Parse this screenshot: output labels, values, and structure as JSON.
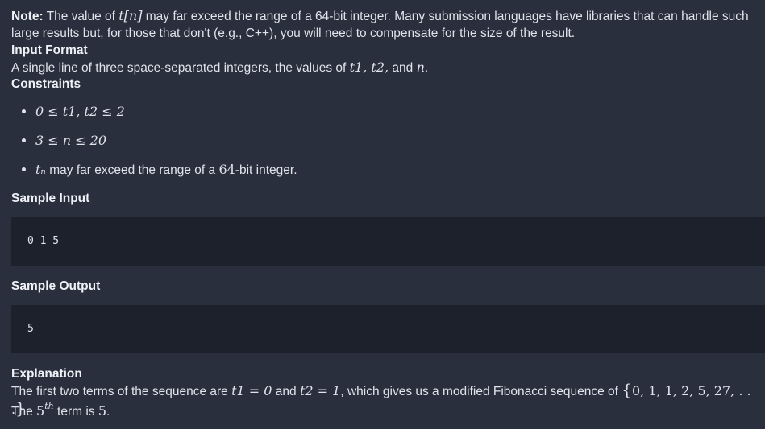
{
  "note": {
    "label": "Note:",
    "text_before": " The value of ",
    "math_t_n": "t[n]",
    "text_after": " may far exceed the range of a 64-bit integer. Many submission languages have libraries that can handle such large results but, for those that don't (e.g., C++), you will need to compensate for the size of the result."
  },
  "input_format": {
    "heading": "Input Format",
    "text_before": "A single line of three space-separated integers, the values of ",
    "math_vars": "t1, t2,",
    "text_and": " and ",
    "math_n": "n",
    "text_end": "."
  },
  "constraints": {
    "heading": "Constraints",
    "items": [
      {
        "math": "0 ≤ t1, t2 ≤ 2"
      },
      {
        "math": "3 ≤ n ≤ 20"
      },
      {
        "math": "tₙ",
        "text": " may far exceed the range of a ",
        "math2": "64",
        "text2": "-bit integer."
      }
    ]
  },
  "sample_input": {
    "heading": "Sample Input",
    "code": "0 1 5"
  },
  "sample_output": {
    "heading": "Sample Output",
    "code": "5"
  },
  "explanation": {
    "heading": "Explanation",
    "line1_before": "The first two terms of the sequence are ",
    "math_t1": "t1 = 0",
    "line1_and": " and ",
    "math_t2": "t2 = 1",
    "line1_after": ", which gives us a modified Fibonacci sequence of ",
    "math_set": "0, 1, 1, 2, 5, 27, . . .",
    "line1_end": ".",
    "line2_before": "The ",
    "math_5": "5",
    "sup_th": "th",
    "line2_after": " term is ",
    "math_5b": "5",
    "line2_end": "."
  }
}
